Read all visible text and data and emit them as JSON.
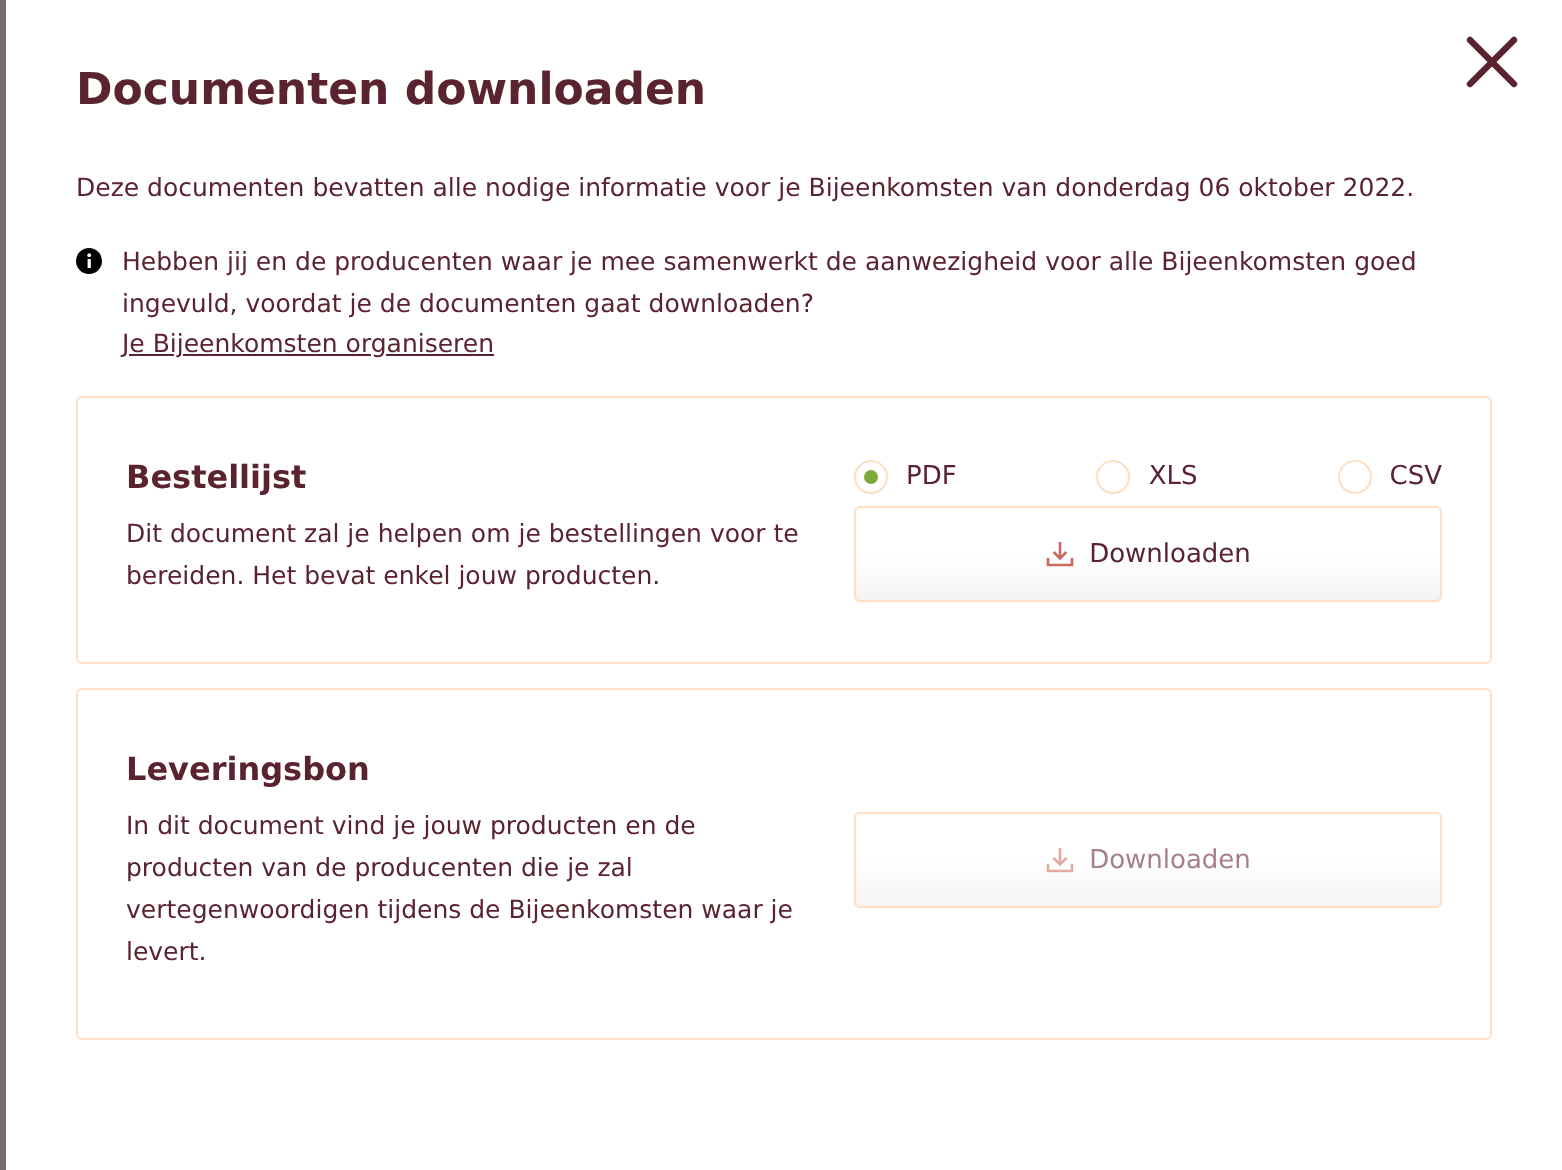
{
  "dialog": {
    "title": "Documenten downloaden",
    "intro": "Deze documenten bevatten alle nodige informatie voor je Bijeenkomsten van donderdag 06 oktober 2022.",
    "notice": {
      "text": "Hebben jij en de producenten waar je mee samenwerkt de aanwezigheid voor alle Bijeenkomsten goed ingevuld, voordat je de documenten gaat downloaden?",
      "link": "Je Bijeenkomsten organiseren"
    },
    "documents": [
      {
        "title": "Bestellijst",
        "description": "Dit document zal je helpen om je bestellingen voor te bereiden. Het bevat enkel jouw producten.",
        "formats": [
          {
            "label": "PDF",
            "selected": true
          },
          {
            "label": "XLS",
            "selected": false
          },
          {
            "label": "CSV",
            "selected": false
          }
        ],
        "button": {
          "label": "Downloaden",
          "disabled": false
        }
      },
      {
        "title": "Leveringsbon",
        "description": "In dit document vind je jouw producten en de producten van de producenten die je zal vertegenwoordigen tijdens de Bijeenkomsten waar je levert.",
        "button": {
          "label": "Downloaden",
          "disabled": true
        }
      }
    ]
  }
}
